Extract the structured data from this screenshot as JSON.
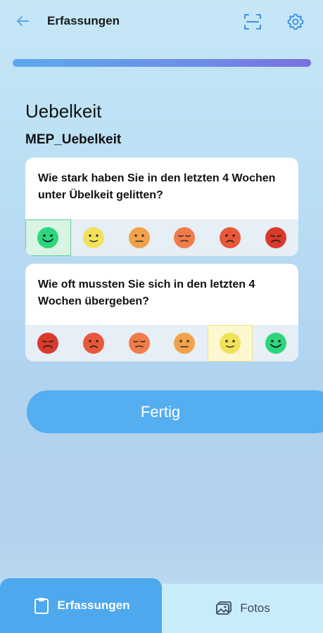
{
  "header": {
    "title": "Erfassungen"
  },
  "progress": {
    "value": 1.0
  },
  "page": {
    "title": "Uebelkeit",
    "subtitle": "MEP_Uebelkeit"
  },
  "questions": [
    {
      "text": "Wie stark haben Sie in den letzten 4 Wochen unter Übelkeit gelitten?",
      "selected_index": 0
    },
    {
      "text": "Wie oft mussten Sie sich in den letzten 4 Wochen übergeben?",
      "selected_index": 4
    }
  ],
  "colors": {
    "accent": "#55aef0",
    "face_green": "#2ed67b",
    "face_yellow": "#f2e25a",
    "face_orange": "#f2a24a",
    "face_orange_red": "#f27b4a",
    "face_red": "#e9583a",
    "face_dark_red": "#d93a2e"
  },
  "actions": {
    "done_label": "Fertig"
  },
  "nav": {
    "tabs": [
      {
        "label": "Erfassungen",
        "icon": "clipboard-icon",
        "active": true
      },
      {
        "label": "Fotos",
        "icon": "photos-icon",
        "active": false
      }
    ]
  }
}
